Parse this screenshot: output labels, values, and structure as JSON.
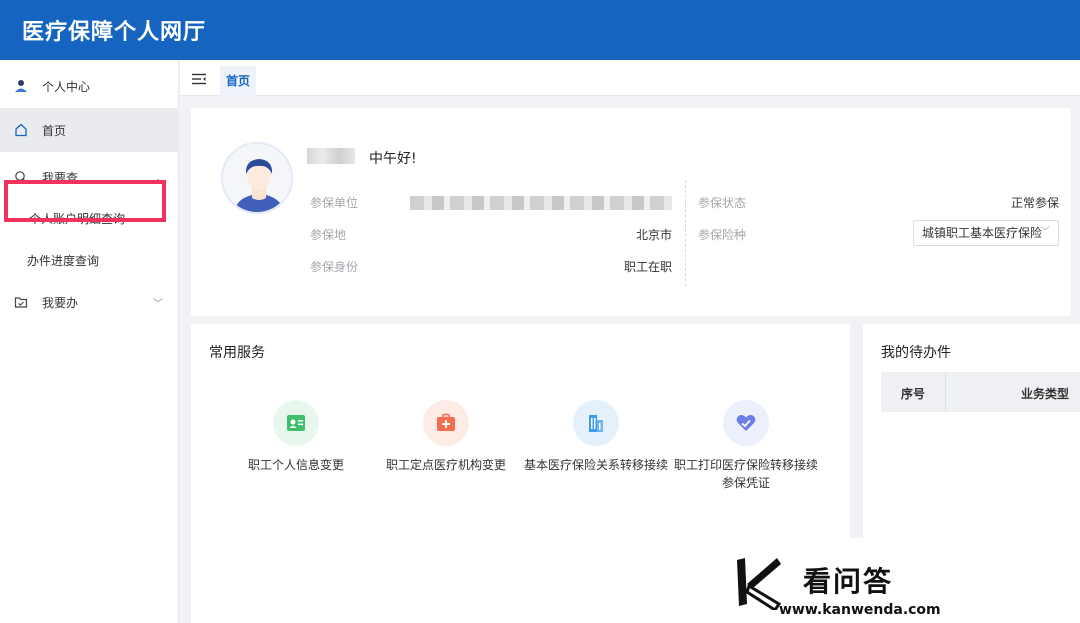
{
  "app": {
    "title": "医疗保障个人网厅"
  },
  "sidebar": {
    "user_center": "个人中心",
    "home": "首页",
    "query": "我要查",
    "query_items": [
      "个人账户明细查询",
      "办件进度查询"
    ],
    "do": "我要办"
  },
  "tabs": {
    "home": "首页"
  },
  "profile": {
    "greeting": "中午好!",
    "fields": {
      "unit_label": "参保单位",
      "location_label": "参保地",
      "location_value": "北京市",
      "identity_label": "参保身份",
      "identity_value": "职工在职",
      "status_label": "参保状态",
      "status_value": "正常参保",
      "insurance_type_label": "参保险种",
      "insurance_type_value": "城镇职工基本医疗保险"
    }
  },
  "services": {
    "title": "常用服务",
    "items": [
      {
        "label": "职工个人信息变更",
        "icon": "id-card-icon",
        "color": "#3fbf6b",
        "bg": "#e8f7ee"
      },
      {
        "label": "职工定点医疗机构变更",
        "icon": "medical-kit-icon",
        "color": "#f26d4f",
        "bg": "#fdebe6"
      },
      {
        "label": "基本医疗保险关系转移接续",
        "icon": "building-icon",
        "color": "#3d9be9",
        "bg": "#e4f1fc"
      },
      {
        "label": "职工打印医疗保险转移接续参保凭证",
        "icon": "heart-plus-icon",
        "color": "#6a7de8",
        "bg": "#eceffc"
      }
    ]
  },
  "todo": {
    "title": "我的待办件",
    "columns": [
      "序号",
      "业务类型"
    ]
  },
  "watermark": {
    "text": "看问答",
    "url": "www.kanwenda.com"
  },
  "colors": {
    "primary": "#1565c0",
    "highlight": "#f0325c"
  }
}
